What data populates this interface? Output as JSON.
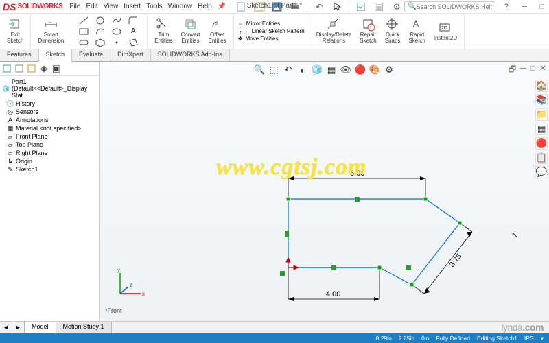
{
  "app": {
    "name": "SOLIDWORKS"
  },
  "doc_title": "Sketch1 of Part1 *",
  "menu": [
    "File",
    "Edit",
    "View",
    "Insert",
    "Tools",
    "Window",
    "Help"
  ],
  "search_placeholder": "Search SOLIDWORKS Help",
  "ribbon": {
    "exit_sketch": "Exit\nSketch",
    "smart_dim": "Smart\nDimension",
    "trim": "Trim\nEntities",
    "convert": "Convert\nEntities",
    "offset": "Offset\nEntities",
    "mirror": "Mirror Entities",
    "linear_pattern": "Linear Sketch Pattern",
    "move": "Move Entities",
    "display_delete": "Display/Delete\nRelations",
    "repair": "Repair\nSketch",
    "quick_snaps": "Quick\nSnaps",
    "rapid": "Rapid\nSketch",
    "instant2d": "Instant2D"
  },
  "tabs": [
    "Features",
    "Sketch",
    "Evaluate",
    "DimXpert",
    "SOLIDWORKS Add-Ins"
  ],
  "active_tab": "Sketch",
  "tree": {
    "root": "Part1 (Default<<Default>_Display Stat",
    "items": [
      "History",
      "Sensors",
      "Annotations",
      "Material <not specified>",
      "Front Plane",
      "Top Plane",
      "Right Plane",
      "Origin",
      "Sketch1"
    ]
  },
  "dimensions": {
    "top": "6.00",
    "side": "3.75",
    "bottom": "4.00"
  },
  "view_label": "*Front",
  "status": {
    "x": "8.29in",
    "y": "2.25in",
    "z": "0in",
    "state": "Fully Defined",
    "context": "Editing Sketch1",
    "units": "IPS"
  },
  "bottom_tabs": [
    "Model",
    "Motion Study 1"
  ],
  "brand": {
    "a": "lynda",
    "b": ".com"
  },
  "watermark": "www.cgtsj.com"
}
